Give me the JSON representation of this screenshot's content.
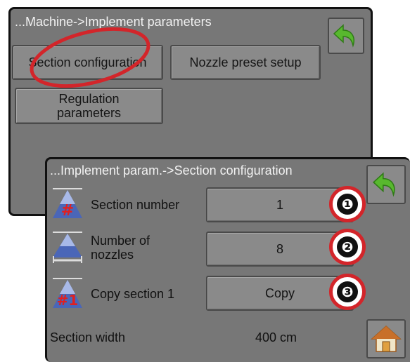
{
  "implement_screen": {
    "breadcrumb": "...Machine->Implement parameters",
    "buttons": {
      "section_configuration": "Section configuration",
      "nozzle_preset_setup": "Nozzle preset setup",
      "regulation_parameters": "Regulation parameters"
    },
    "back_icon": "back-arrow-icon"
  },
  "section_screen": {
    "breadcrumb": "...Implement param.->Section configuration",
    "rows": [
      {
        "label": "Section number",
        "value": "1",
        "icon": "section-number-icon"
      },
      {
        "label": "Number of nozzles",
        "value": "8",
        "icon": "nozzles-icon"
      },
      {
        "label": "Copy section 1",
        "value": "Copy",
        "icon": "copy-section-icon"
      }
    ],
    "section_width_label": "Section width",
    "section_width_value": "400 cm",
    "back_icon": "back-arrow-icon",
    "home_icon": "home-icon"
  },
  "callouts": [
    "❶",
    "❷",
    "❸"
  ],
  "colors": {
    "screen_bg": "#777777",
    "button_bg": "#8a8a8a",
    "highlight_red": "#d3252a",
    "back_arrow_green": "#58b82e"
  }
}
